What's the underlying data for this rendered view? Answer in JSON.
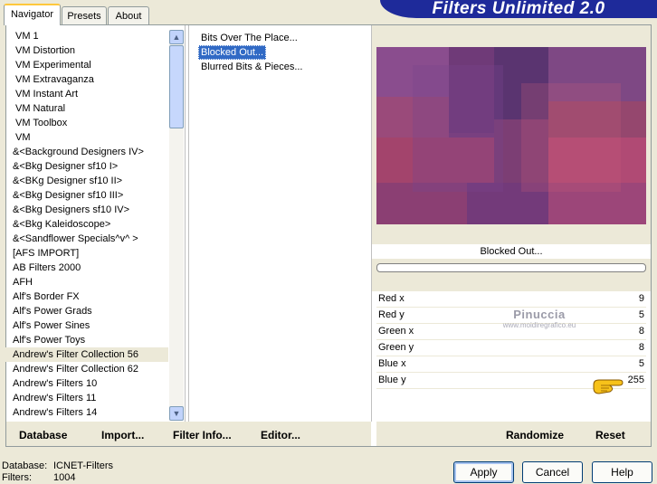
{
  "tabs": [
    "Navigator",
    "Presets",
    "About"
  ],
  "banner_title": "Filters Unlimited 2.0",
  "categories": [
    {
      "label": "VM 1",
      "selected": false
    },
    {
      "label": "VM Distortion",
      "selected": false
    },
    {
      "label": "VM Experimental",
      "selected": false
    },
    {
      "label": "VM Extravaganza",
      "selected": false
    },
    {
      "label": "VM Instant Art",
      "selected": false
    },
    {
      "label": "VM Natural",
      "selected": false
    },
    {
      "label": "VM Toolbox",
      "selected": false
    },
    {
      "label": "VM",
      "selected": false
    },
    {
      "label": "&<Background Designers IV>",
      "selected": false
    },
    {
      "label": "&<Bkg Designer sf10 I>",
      "selected": false
    },
    {
      "label": "&<BKg Designer sf10 II>",
      "selected": false
    },
    {
      "label": "&<Bkg Designer sf10 III>",
      "selected": false
    },
    {
      "label": "&<Bkg Designers sf10 IV>",
      "selected": false
    },
    {
      "label": "&<Bkg Kaleidoscope>",
      "selected": false
    },
    {
      "label": "&<Sandflower Specials^v^ >",
      "selected": false
    },
    {
      "label": "[AFS IMPORT]",
      "selected": false
    },
    {
      "label": "AB Filters 2000",
      "selected": false
    },
    {
      "label": "AFH",
      "selected": false
    },
    {
      "label": "Alf's Border FX",
      "selected": false
    },
    {
      "label": "Alf's Power Grads",
      "selected": false
    },
    {
      "label": "Alf's Power Sines",
      "selected": false
    },
    {
      "label": "Alf's Power Toys",
      "selected": false
    },
    {
      "label": "Andrew's Filter Collection 56",
      "selected": true
    },
    {
      "label": "Andrew's Filter Collection 62",
      "selected": false
    },
    {
      "label": "Andrew's Filters 10",
      "selected": false
    },
    {
      "label": "Andrew's Filters 11",
      "selected": false
    },
    {
      "label": "Andrew's Filters 14",
      "selected": false
    }
  ],
  "filters": [
    {
      "label": "Bits Over The Place...",
      "selected": false
    },
    {
      "label": "Blocked Out...",
      "selected": true
    },
    {
      "label": "Blurred Bits & Pieces...",
      "selected": false
    }
  ],
  "preview_caption": "Blocked Out...",
  "params": [
    {
      "name": "Red x",
      "value": "9"
    },
    {
      "name": "Red y",
      "value": "5"
    },
    {
      "name": "Green x",
      "value": "8"
    },
    {
      "name": "Green y",
      "value": "8"
    },
    {
      "name": "Blue x",
      "value": "5"
    },
    {
      "name": "Blue y",
      "value": "255"
    }
  ],
  "watermark": {
    "line1": "Pinuccia",
    "line2": "www.moidiregrafico.eu"
  },
  "left_links": [
    "Database",
    "Import...",
    "Filter Info...",
    "Editor..."
  ],
  "right_links": [
    "Randomize",
    "Reset"
  ],
  "status": {
    "db_label": "Database:",
    "db_value": "ICNET-Filters",
    "filters_label": "Filters:",
    "filters_value": "1004"
  },
  "buttons": {
    "apply": "Apply",
    "cancel": "Cancel",
    "help": "Help"
  },
  "icons": {
    "scroll_up": "triangle-up",
    "scroll_down": "triangle-down",
    "pointer": "pointing-hand"
  }
}
